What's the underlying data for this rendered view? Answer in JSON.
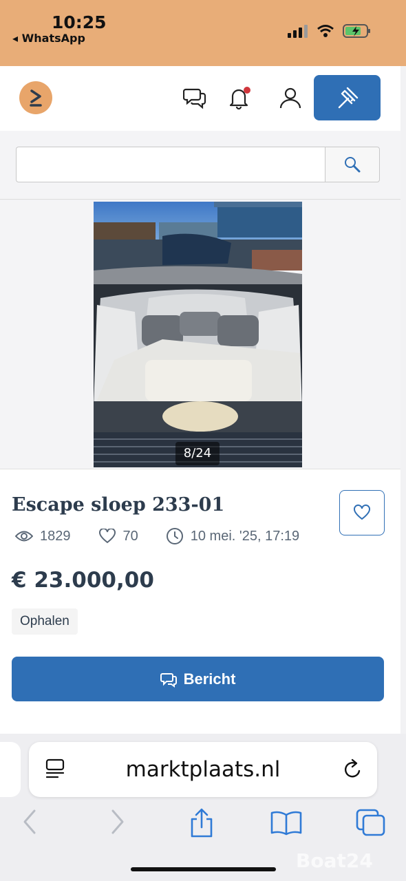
{
  "status_bar": {
    "time": "10:25",
    "back_app": "◂ WhatsApp"
  },
  "search": {
    "value": ""
  },
  "gallery": {
    "counter": "8/24"
  },
  "listing": {
    "title": "Escape sloep 233-01",
    "views": "1829",
    "favorites": "70",
    "date": "10 mei. '25, 17:19",
    "price": "€ 23.000,00",
    "delivery": "Ophalen",
    "message_label": "Bericht"
  },
  "browser": {
    "url": "marktplaats.nl"
  },
  "watermark": "Boat24",
  "colors": {
    "brand_blue": "#2f6fb5",
    "status_bar": "#e8ad78",
    "logo": "#e8a56a",
    "notification_dot": "#d0363c"
  }
}
